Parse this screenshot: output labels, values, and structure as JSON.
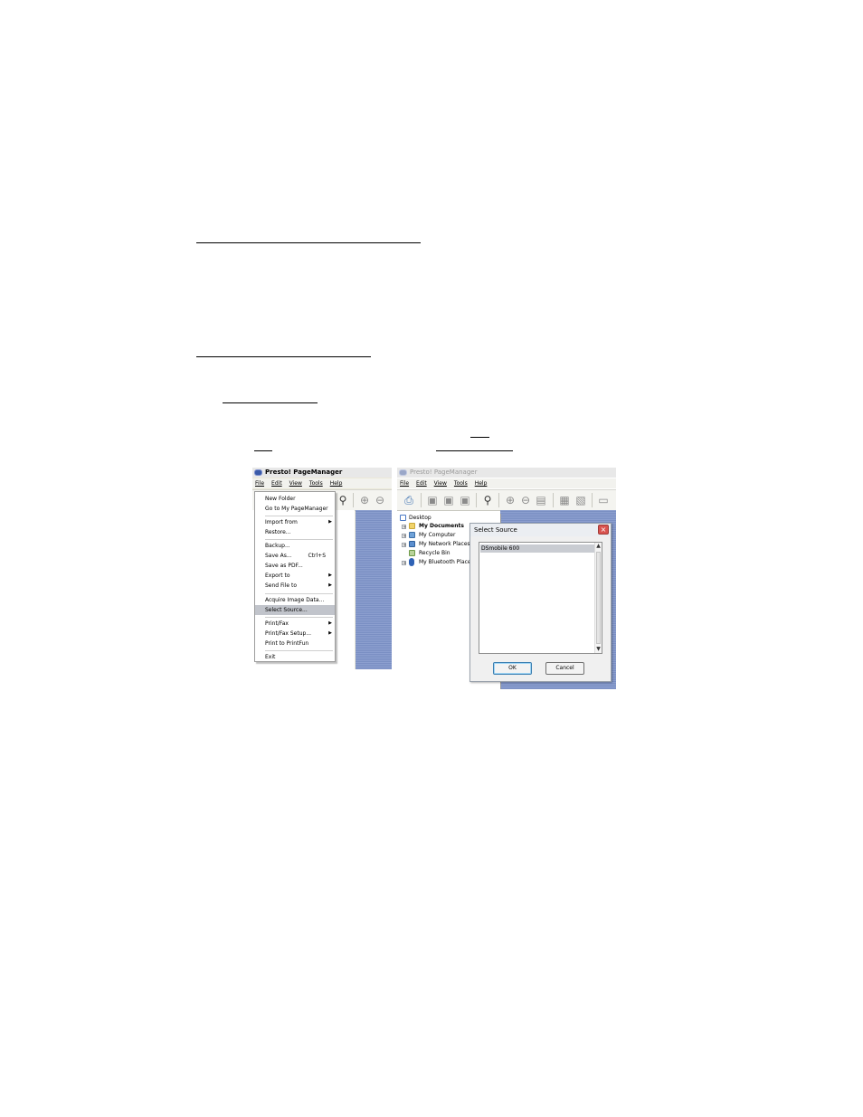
{
  "left_window": {
    "title": "Presto! PageManager",
    "menus": [
      "File",
      "Edit",
      "View",
      "Tools",
      "Help"
    ],
    "file_menu": {
      "items": [
        {
          "label": "New Folder"
        },
        {
          "label": "Go to My PageManager"
        },
        {
          "label": "Import from",
          "submenu": true
        },
        {
          "label": "Restore..."
        },
        {
          "label": "Backup..."
        },
        {
          "label": "Save As...",
          "shortcut": "Ctrl+S"
        },
        {
          "label": "Save as PDF..."
        },
        {
          "label": "Export to",
          "submenu": true
        },
        {
          "label": "Send File to",
          "submenu": true
        },
        {
          "label": "Acquire Image Data..."
        },
        {
          "label": "Select Source...",
          "selected": true
        },
        {
          "label": "Print/Fax",
          "submenu": true
        },
        {
          "label": "Print/Fax Setup...",
          "submenu": true
        },
        {
          "label": "Print to PrintFun"
        },
        {
          "label": "Exit"
        }
      ]
    }
  },
  "right_window": {
    "title": "Presto! PageManager",
    "menus": [
      "File",
      "Edit",
      "View",
      "Tools",
      "Help"
    ],
    "tree": {
      "root": "Desktop",
      "items": [
        "My Documents",
        "My Computer",
        "My Network Places",
        "Recycle Bin",
        "My Bluetooth Places"
      ]
    }
  },
  "dialog": {
    "title": "Select Source",
    "sources": [
      "DSmobile 600"
    ],
    "ok_label": "OK",
    "cancel_label": "Cancel"
  },
  "icons": {
    "submenu_arrow": "triangle-right-icon",
    "close": "close-icon",
    "scroll_up": "chevron-up-icon",
    "scroll_down": "chevron-down-icon",
    "zoom_in": "zoom-in-icon",
    "zoom_out": "zoom-out-icon",
    "scan": "scan-icon"
  },
  "colors": {
    "menu_highlight": "#c1c4cb",
    "workspace_blue": "#7a8fc3",
    "close_button": "#d9534f"
  }
}
